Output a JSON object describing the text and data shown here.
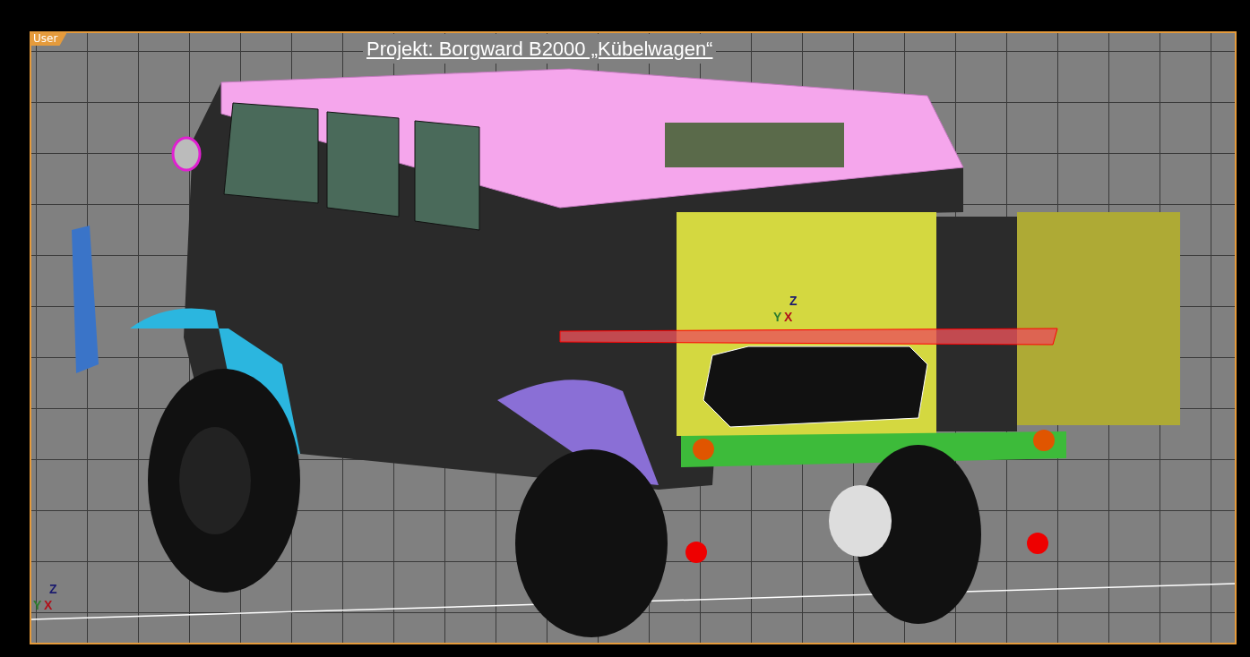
{
  "viewport": {
    "label": "User",
    "title": "Projekt: Borgward B2000 „Kübelwagen“",
    "gizmo_axes": [
      "Z",
      "Y",
      "X"
    ],
    "corner_axes": [
      "Z",
      "Y",
      "X"
    ]
  }
}
